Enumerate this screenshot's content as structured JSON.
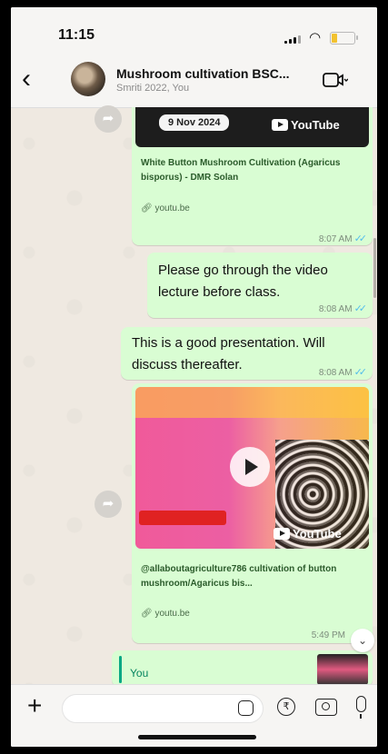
{
  "status_bar": {
    "time": "11:15",
    "icons": [
      "signal-icon",
      "wifi-icon",
      "battery-icon"
    ]
  },
  "header": {
    "back_icon": "chevron-left-icon",
    "title": "Mushroom cultivation BSC...",
    "subtitle": "Smriti 2022, You",
    "video_icon": "video-call-icon"
  },
  "messages": [
    {
      "type": "link_preview",
      "date_label": "9 Nov 2024",
      "source_logo": "YouTube",
      "link_title": "White Button Mushroom Cultivation (Agaricus bisporus) - DMR Solan",
      "link_domain": "youtu.be",
      "time": "8:07 AM",
      "read": true
    },
    {
      "type": "text",
      "text": "Please go through the video lecture before class.",
      "time": "8:08 AM",
      "read": true
    },
    {
      "type": "text",
      "text": "This is a good presentation. Will discuss thereafter.",
      "time": "8:08 AM",
      "read": true
    },
    {
      "type": "video_preview",
      "source_logo": "YouTube",
      "link_title": "@allaboutagriculture786  cultivation of button mushroom/Agaricus bis...",
      "link_domain": "youtu.be",
      "time": "5:49 PM"
    },
    {
      "type": "reply",
      "quoted_author": "You"
    }
  ],
  "input_bar": {
    "icons": [
      "plus-icon",
      "sticker-icon",
      "rupee-payment-icon",
      "camera-icon",
      "mic-icon"
    ]
  },
  "colors": {
    "outgoing_bubble": "#d9fdd3",
    "chat_background": "#efe9e1",
    "read_ticks": "#53bdeb",
    "link_title": "#2b5b2b"
  }
}
